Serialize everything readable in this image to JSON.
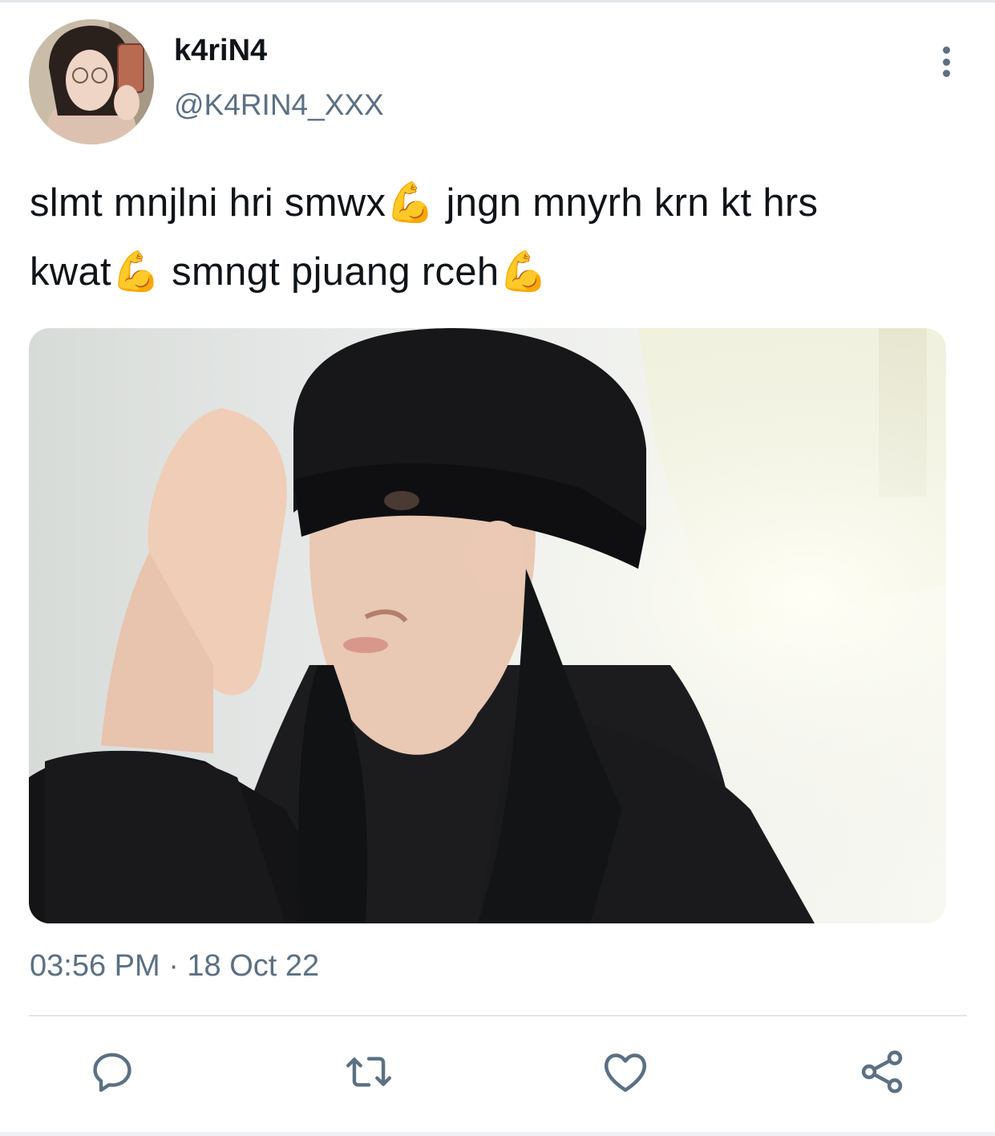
{
  "tweet": {
    "display_name": "k4riN4",
    "handle": "@K4RIN4_XXX",
    "text_line1": "slmt mnjlni hri smwx💪 jngn mnyrh krn kt hrs",
    "text_line2": "kwat💪 smngt pjuang rceh💪",
    "timestamp": "03:56 PM · 18 Oct 22"
  },
  "icons": {
    "more": "more-vertical-icon",
    "reply": "reply-icon",
    "retweet": "retweet-icon",
    "like": "heart-icon",
    "share": "share-icon"
  },
  "colors": {
    "text_primary": "#0f1419",
    "text_secondary": "#5b7083",
    "divider": "#e3e6ea",
    "background": "#ffffff"
  }
}
